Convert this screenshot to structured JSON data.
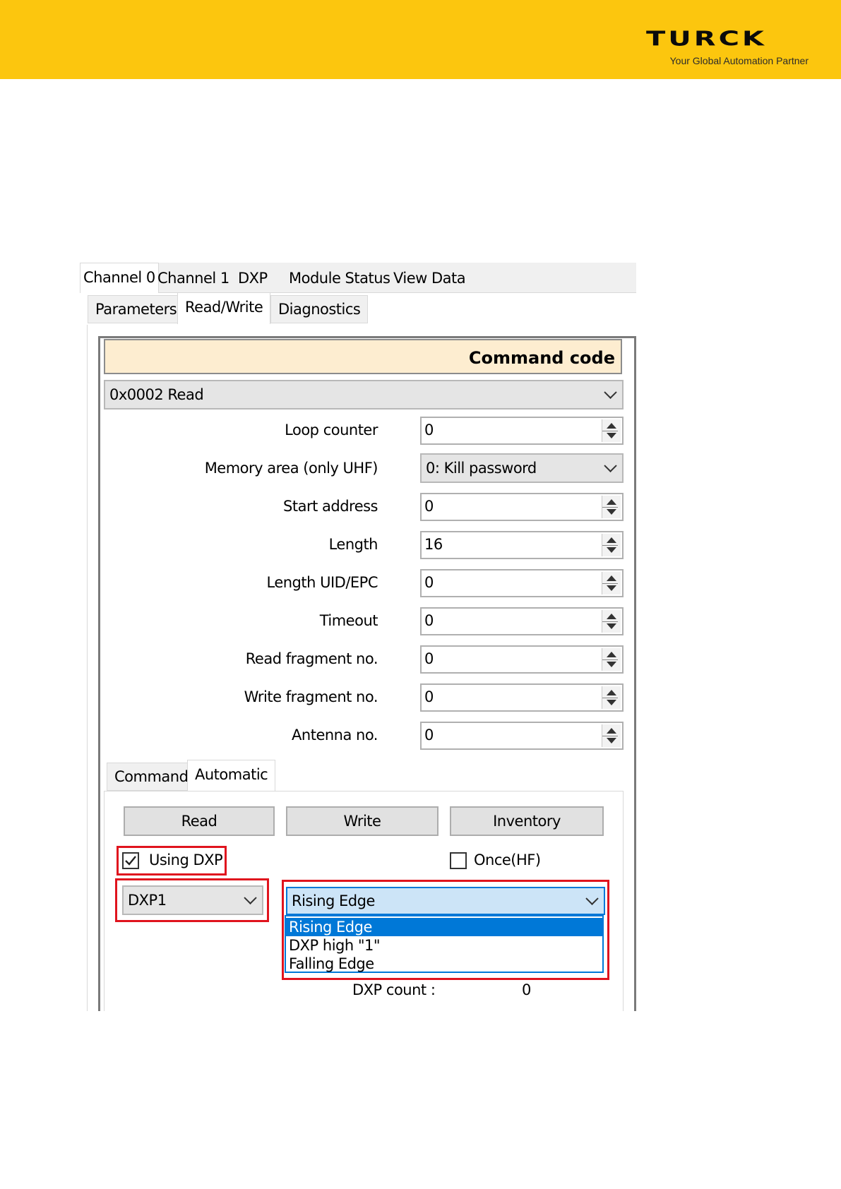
{
  "header": {
    "logo_text": "TURCK",
    "tagline": "Your Global Automation Partner",
    "bar_color": "#fcc60e"
  },
  "tabs": [
    "Channel 0",
    "Channel 1",
    "DXP",
    "Module Status",
    "View Data"
  ],
  "subtabs": [
    "Parameters",
    "Read/Write",
    "Diagnostics"
  ],
  "command_code": {
    "header": "Command code",
    "value": "0x0002 Read"
  },
  "fields": {
    "loop_counter": {
      "label": "Loop counter",
      "value": "0"
    },
    "memory_area": {
      "label": "Memory area (only UHF)",
      "value": "0: Kill password"
    },
    "start_address": {
      "label": "Start address",
      "value": "0"
    },
    "length": {
      "label": "Length",
      "value": "16"
    },
    "length_uid": {
      "label": "Length UID/EPC",
      "value": "0"
    },
    "timeout": {
      "label": "Timeout",
      "value": "0"
    },
    "read_fragment": {
      "label": "Read fragment no.",
      "value": "0"
    },
    "write_fragment": {
      "label": "Write fragment no.",
      "value": "0"
    },
    "antenna": {
      "label": "Antenna no.",
      "value": "0"
    }
  },
  "lower_tabs": [
    "Command",
    "Automatic"
  ],
  "buttons": {
    "read": "Read",
    "write": "Write",
    "inventory": "Inventory"
  },
  "using_dxp": {
    "label": "Using DXP",
    "checked": true
  },
  "once_hf": {
    "label": "Once(HF)",
    "checked": false
  },
  "dxp_select": {
    "value": "DXP1"
  },
  "edge_select": {
    "value": "Rising Edge",
    "options": [
      "Rising Edge",
      "DXP high \"1\"",
      "Falling Edge"
    ],
    "selected_index": 0
  },
  "dxp_count": {
    "label": "DXP count :",
    "value": "0"
  },
  "colors": {
    "highlight": "#e0141e",
    "selection": "#0078d7"
  }
}
